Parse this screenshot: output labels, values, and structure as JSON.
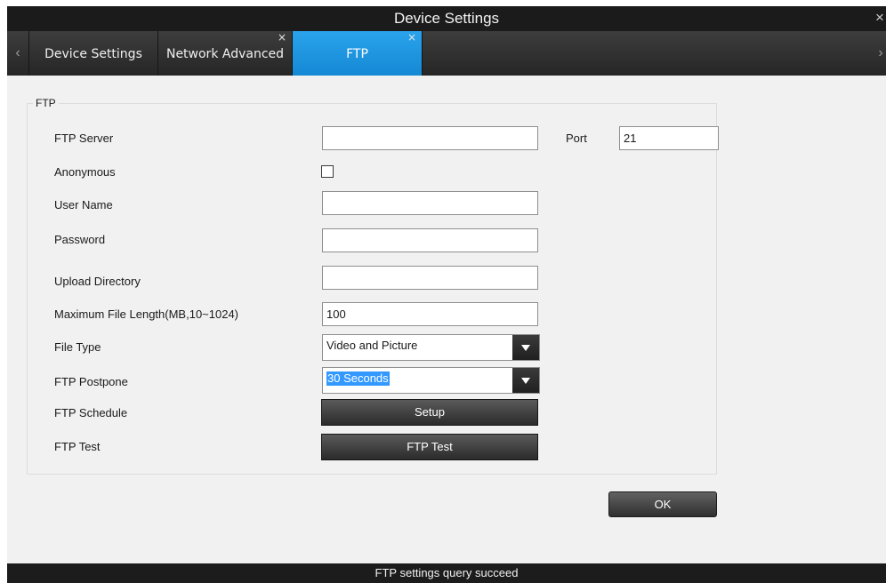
{
  "window": {
    "title": "Device Settings",
    "close_icon": "close-icon"
  },
  "tabs": [
    {
      "label": "Device Settings",
      "active": false,
      "closable": false
    },
    {
      "label": "Network Advanced",
      "active": false,
      "closable": true
    },
    {
      "label": "FTP",
      "active": true,
      "closable": true
    }
  ],
  "tab_nav": {
    "prev_icon": "chevron-left-icon",
    "next_icon": "chevron-right-icon",
    "close_glyph": "×",
    "prev_glyph": "‹",
    "next_glyph": "›"
  },
  "ftp": {
    "group_title": "FTP",
    "server": {
      "label": "FTP Server",
      "value": ""
    },
    "port": {
      "label": "Port",
      "value": "21"
    },
    "anonymous": {
      "label": "Anonymous",
      "checked": false
    },
    "username": {
      "label": "User Name",
      "value": ""
    },
    "password": {
      "label": "Password",
      "value": ""
    },
    "upload_dir": {
      "label": "Upload Directory",
      "value": ""
    },
    "max_file_length": {
      "label": "Maximum File Length(MB,10~1024)",
      "value": "100"
    },
    "file_type": {
      "label": "File Type",
      "value": "Video and Picture"
    },
    "postpone": {
      "label": "FTP Postpone",
      "value": "30 Seconds"
    },
    "schedule": {
      "label": "FTP Schedule",
      "button": "Setup"
    },
    "test": {
      "label": "FTP Test",
      "button": "FTP Test"
    }
  },
  "actions": {
    "ok": "OK"
  },
  "status": {
    "message": "FTP  settings query succeed"
  },
  "colors": {
    "accent": "#1f97e2",
    "titlebar": "#1b1b1b",
    "content_bg": "#f1f1f1"
  }
}
